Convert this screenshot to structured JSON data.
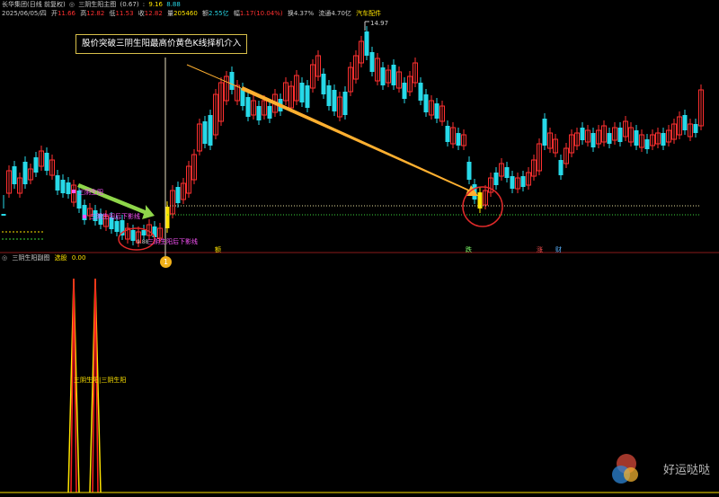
{
  "header": {
    "stock_name": "长华集团(日线 前复权)",
    "indicator": "三阴生阳主图",
    "params": "(0.67)",
    "val1": "9.16",
    "val2": "8.88",
    "date": "2025/06/05/四",
    "open_label": "开",
    "open": "11.66",
    "high_label": "高",
    "high": "12.82",
    "low_label": "低",
    "low": "11.53",
    "close_label": "收",
    "close": "12.82",
    "volume_label": "量",
    "volume": "205460",
    "amount_label": "额",
    "amount": "2.55亿",
    "change_label": "幅",
    "change": "1.17(10.04%)",
    "turnover_label": "换",
    "turnover": "4.37%",
    "float_label": "流通",
    "float_cap": "4.70亿",
    "sector": "汽车配件"
  },
  "main": {
    "callout_text": "股价突破三阴生阳最高价黄色K线择机介入",
    "high_marker": "14.97",
    "signal_sanyin_shengyang": "三阴生阳",
    "signal_lower_shadow_top": "三阴生阳后下影线",
    "signal_lower_shadow_bottom": "三阴生阳后下影线",
    "marker_tiny": "9.88",
    "circle_number": "1",
    "bottom_tags": [
      "额",
      "跌",
      "涨",
      "财"
    ]
  },
  "sub": {
    "indicator_name": "三阴生阳副图",
    "select_label": "选股",
    "select_value": "0.00",
    "peak_label": "三阴生阳|三阴生阳"
  },
  "watermark": "好运哒哒",
  "colors": {
    "up": "#ff3030",
    "down": "#27d9e8",
    "yellow": "#ffe400",
    "arrow_green": "#8fd64a",
    "arrow_orange": "#ffb030",
    "circle": "#e02a2a"
  }
}
